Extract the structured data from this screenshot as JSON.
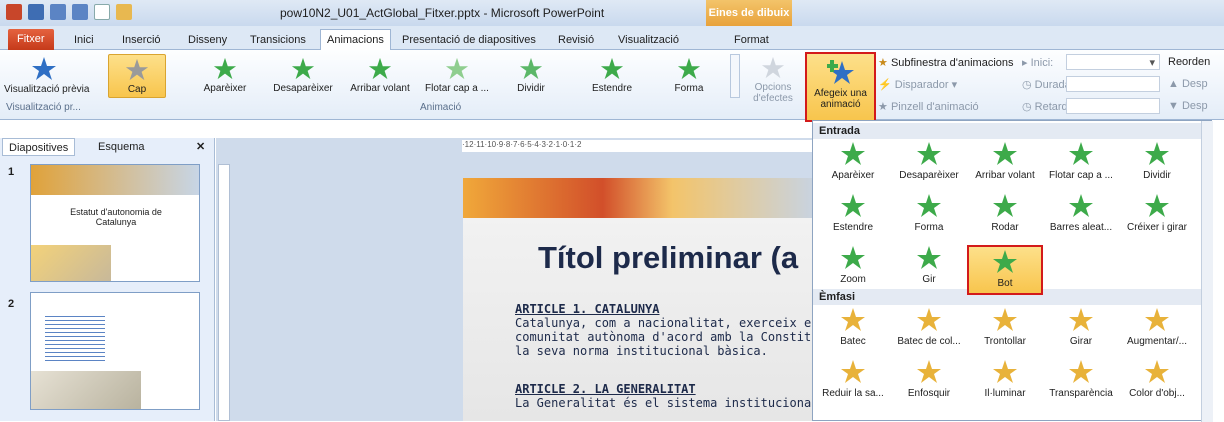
{
  "window": {
    "title": "pow10N2_U01_ActGlobal_Fitxer.pptx - Microsoft PowerPoint",
    "context_tab_group": "Eines de dibuix"
  },
  "tabs": [
    "Fitxer",
    "Inici",
    "Inserció",
    "Disseny",
    "Transicions",
    "Animacions",
    "Presentació de diapositives",
    "Revisió",
    "Visualització",
    "Format"
  ],
  "active_tab": "Animacions",
  "ribbon": {
    "preview_label": "Visualització prèvia",
    "preview_group": "Visualització pr...",
    "animation_group": "Animació",
    "gallery": [
      "Cap",
      "Aparèixer",
      "Desaparèixer",
      "Arribar volant",
      "Flotar cap a ...",
      "Dividir",
      "Estendre",
      "Forma"
    ],
    "effect_options": "Opcions d'efectes",
    "add_animation": "Afegeix una animació",
    "animation_pane": "Subfinestra d'animacions",
    "trigger": "Disparador",
    "painter": "Pinzell d'animació",
    "start": "Inici:",
    "duration": "Durada:",
    "delay": "Retard:",
    "reorder": "Reorden",
    "reorder_up": "Desp",
    "reorder_down": "Desp"
  },
  "pane": {
    "tab_slides": "Diapositives",
    "tab_outline": "Esquema",
    "slide1_num": "1",
    "slide1_title": "Estatut d'autonomia de Catalunya",
    "slide2_num": "2"
  },
  "ruler_text": "·12·11·10·9·8·7·6·5·4·3·2·1·0·1·2",
  "slide": {
    "title": "Títol preliminar (a",
    "art1_head": "ARTICLE 1. CATALUNYA",
    "art1_line1": "Catalunya, com a nacionalitat, exerceix el se",
    "art1_line2": "comunitat autònoma d'acord amb la Constitu",
    "art1_line3": "la seva norma institucional bàsica.",
    "art2_head": "ARTICLE 2. LA GENERALITAT",
    "art2_line1": "La Generalitat és el sistema institucional en q"
  },
  "dropdown": {
    "entrance": "Entrada",
    "entrance_items": [
      "Aparèixer",
      "Desaparèixer",
      "Arribar volant",
      "Flotar cap a ...",
      "Dividir",
      "Estendre",
      "Forma",
      "Rodar",
      "Barres aleat...",
      "Créixer i girar",
      "Zoom",
      "Gir",
      "Bot"
    ],
    "emphasis": "Èmfasi",
    "emphasis_items": [
      "Batec",
      "Batec de col...",
      "Trontollar",
      "Girar",
      "Augmentar/...",
      "Reduir la sa...",
      "Enfosquir",
      "Il·luminar",
      "Transparència",
      "Color d'obj..."
    ]
  },
  "colors": {
    "entrance": "#3daa4a",
    "emphasis": "#e8b23a",
    "selected": "#f8c54d",
    "highlight": "#d31a1a"
  }
}
